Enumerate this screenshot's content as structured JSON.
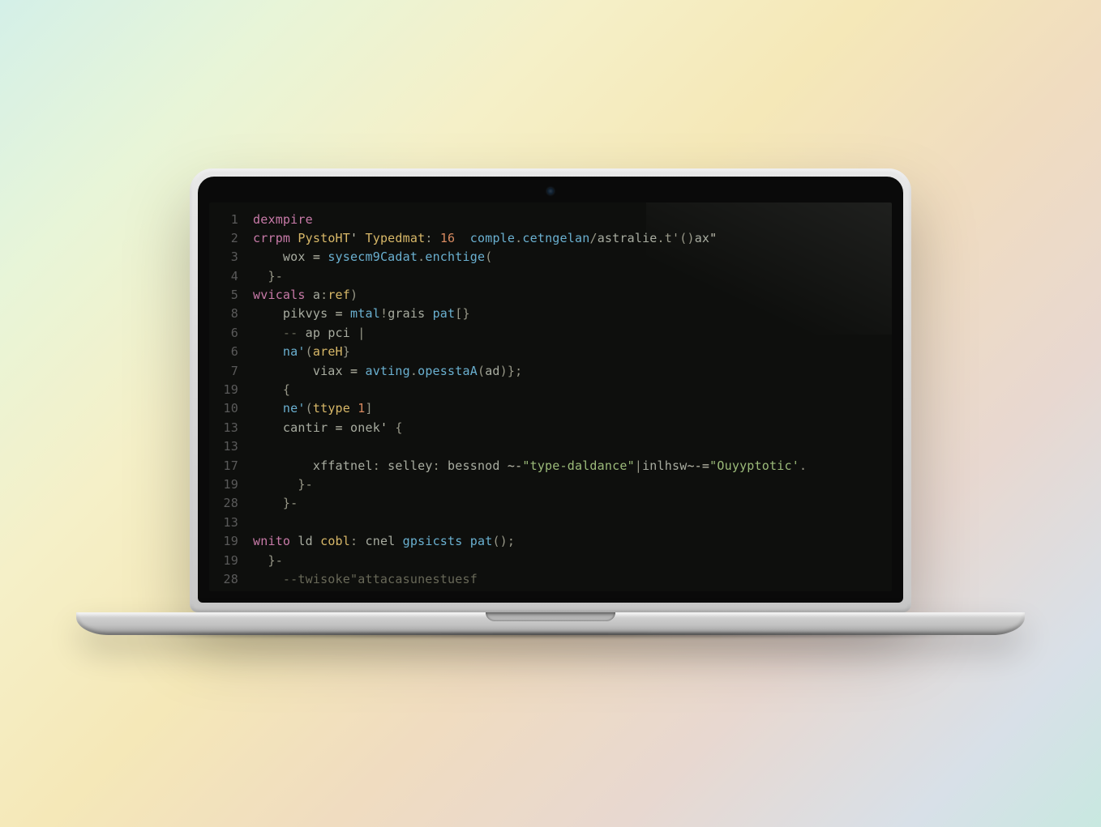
{
  "editor": {
    "gutter": [
      "1",
      "2",
      "3",
      "4",
      "5",
      "8",
      "6",
      "6",
      "7",
      "19",
      "10",
      "13",
      "13",
      "17",
      "19",
      "28",
      "13",
      "19",
      "19",
      "28"
    ],
    "lines": [
      [
        [
          "kw",
          "dexmpire"
        ]
      ],
      [
        [
          "kw",
          "crrpm "
        ],
        [
          "type",
          "PystoHT"
        ],
        [
          "op",
          "' "
        ],
        [
          "type",
          "Typedmat"
        ],
        [
          "pun",
          ": "
        ],
        [
          "num",
          "16"
        ],
        [
          "op",
          "  "
        ],
        [
          "fn",
          "comple"
        ],
        [
          "pun",
          "."
        ],
        [
          "fn",
          "cetngelan"
        ],
        [
          "pun",
          "/"
        ],
        [
          "var",
          "astralie"
        ],
        [
          "pun",
          ".t'()"
        ],
        [
          "var",
          "ax"
        ],
        [
          "op",
          "\""
        ]
      ],
      [
        [
          "var",
          "    wox "
        ],
        [
          "op",
          "= "
        ],
        [
          "fn",
          "sysecm9Cadat"
        ],
        [
          "pun",
          "."
        ],
        [
          "fn",
          "enchtige"
        ],
        [
          "pun",
          "("
        ]
      ],
      [
        [
          "pun",
          "  }-"
        ]
      ],
      [
        [
          "kw",
          "wvicals "
        ],
        [
          "var",
          "a"
        ],
        [
          "pun",
          ":"
        ],
        [
          "type",
          "ref"
        ],
        [
          "pun",
          ")"
        ]
      ],
      [
        [
          "var",
          "    pikvys "
        ],
        [
          "op",
          "= "
        ],
        [
          "fn",
          "mtal"
        ],
        [
          "pun",
          "!"
        ],
        [
          "var",
          "grais "
        ],
        [
          "fn",
          "pat"
        ],
        [
          "pun",
          "[}"
        ]
      ],
      [
        [
          "cm",
          "    -- "
        ],
        [
          "var",
          "ap pci"
        ],
        [
          "pun",
          " |"
        ]
      ],
      [
        [
          "fn",
          "    na'"
        ],
        [
          "pun",
          "("
        ],
        [
          "type",
          "areH"
        ],
        [
          "pun",
          "}"
        ]
      ],
      [
        [
          "var",
          "        viax "
        ],
        [
          "op",
          "= "
        ],
        [
          "fn",
          "avting"
        ],
        [
          "pun",
          "."
        ],
        [
          "fn",
          "opesstaA"
        ],
        [
          "pun",
          "("
        ],
        [
          "var",
          "ad"
        ],
        [
          "pun",
          ")};"
        ]
      ],
      [
        [
          "pun",
          "    {"
        ]
      ],
      [
        [
          "fn",
          "    ne'"
        ],
        [
          "pun",
          "("
        ],
        [
          "type",
          "ttype "
        ],
        [
          "num",
          "1"
        ],
        [
          "pun",
          "]"
        ]
      ],
      [
        [
          "var",
          "    cantir "
        ],
        [
          "op",
          "= "
        ],
        [
          "var",
          "onek"
        ],
        [
          "op",
          "' "
        ],
        [
          "pun",
          "{"
        ]
      ],
      [
        [
          "",
          ""
        ]
      ],
      [
        [
          "var",
          "        xffatnel"
        ],
        [
          "pun",
          ": "
        ],
        [
          "var",
          "selley"
        ],
        [
          "pun",
          ": "
        ],
        [
          "var",
          "bessnod "
        ],
        [
          "op",
          "~-"
        ],
        [
          "str",
          "\"type-daldance\""
        ],
        [
          "pun",
          "|"
        ],
        [
          "var",
          "inlhsw"
        ],
        [
          "op",
          "~-="
        ],
        [
          "str",
          "\"Ouyyptotic'"
        ],
        [
          "pun",
          "."
        ]
      ],
      [
        [
          "pun",
          "      }-"
        ]
      ],
      [
        [
          "pun",
          "    }-"
        ]
      ],
      [
        [
          "",
          ""
        ]
      ],
      [
        [
          "kw",
          "wnito "
        ],
        [
          "var",
          "ld "
        ],
        [
          "type",
          "cobl"
        ],
        [
          "pun",
          ": "
        ],
        [
          "var",
          "cnel "
        ],
        [
          "fn",
          "gpsicsts "
        ],
        [
          "fn",
          "pat"
        ],
        [
          "pun",
          "();"
        ]
      ],
      [
        [
          "pun",
          "  }-"
        ]
      ],
      [
        [
          "cm",
          "    --twisoke\"attacasunestuesf"
        ]
      ]
    ]
  }
}
